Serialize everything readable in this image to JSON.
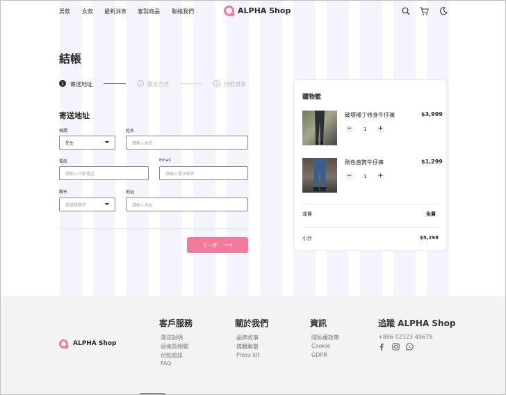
{
  "nav": {
    "items": [
      "男款",
      "女款",
      "最新消息",
      "客製商品",
      "聯絡我們"
    ]
  },
  "brand": {
    "name": "ALPHA Shop",
    "accent": "#f27a9b"
  },
  "header_icons": [
    "search-icon",
    "cart-icon",
    "moon-icon"
  ],
  "page_title": "結帳",
  "steps": [
    {
      "number": "1",
      "label": "寄送地址",
      "active": true
    },
    {
      "number": "2",
      "label": "運送方式",
      "active": false
    },
    {
      "number": "3",
      "label": "付款資訊",
      "active": false
    }
  ],
  "form": {
    "section_title": "寄送地址",
    "salutation": {
      "label": "稱謂",
      "value": "先生"
    },
    "name": {
      "label": "姓名",
      "placeholder": "請輸入姓名"
    },
    "phone": {
      "label": "電話",
      "placeholder": "請輸入行動電話"
    },
    "email": {
      "label": "Email",
      "placeholder": "請輸入電子郵件"
    },
    "city": {
      "label": "縣市",
      "value": "請選擇縣市"
    },
    "address": {
      "label": "地址",
      "placeholder": "請輸入地址"
    },
    "next_label": "下一步",
    "next_arrow": "⟶"
  },
  "cart": {
    "title": "購物籃",
    "items": [
      {
        "name": "破壞補丁修身牛仔褲",
        "price": "$3,999",
        "qty": "1"
      },
      {
        "name": "刷色直筒牛仔褲",
        "price": "$1,299",
        "qty": "1"
      }
    ],
    "minus": "−",
    "plus": "+",
    "shipping_label": "運費",
    "shipping_value": "免費",
    "subtotal_label": "小計",
    "subtotal_value": "$5,298"
  },
  "footer": {
    "brand": "ALPHA Shop",
    "columns": [
      {
        "title": "客戶服務",
        "links": [
          "運送說明",
          "退換貨相關",
          "付款資訊",
          "FAQ"
        ]
      },
      {
        "title": "關於我們",
        "links": [
          "品牌故事",
          "媒體聯繫",
          "Press kit"
        ]
      },
      {
        "title": "資訊",
        "links": [
          "隱私權政策",
          "Cookie",
          "GDPR"
        ]
      }
    ],
    "follow": {
      "title": "追蹤 ALPHA Shop",
      "phone": "+886 02123-45678",
      "social": [
        "facebook-icon",
        "instagram-icon",
        "whatsapp-icon"
      ]
    }
  }
}
